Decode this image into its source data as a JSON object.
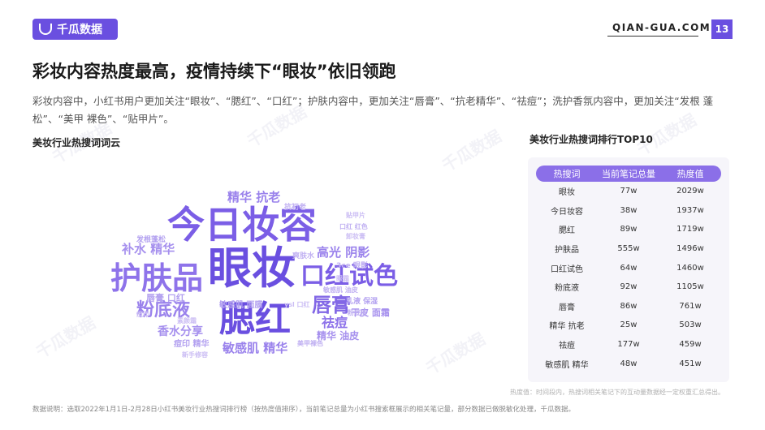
{
  "header": {
    "logo_text": "千瓜数据",
    "site": "QIAN-GUA.COM",
    "page_number": "13",
    "brand_color": "#6a4fe0"
  },
  "title": "彩妆内容热度最高，疫情持续下“眼妆”依旧领跑",
  "description": "彩妆内容中，小红书用户更加关注“眼妆”、“腮红”、“口红”；护肤内容中，更加关注“唇膏”、“抗老精华”、“祛痘”；洗护香氛内容中，更加关注“发根 蓬松”、“美甲 裸色”、“贴甲片”。",
  "word_cloud": {
    "title": "美妆行业热搜词词云",
    "words": [
      {
        "text": "今日妆容",
        "color": "#7b5ee6"
      },
      {
        "text": "眼妆",
        "color": "#6a4fe0"
      },
      {
        "text": "护肤品",
        "color": "#8e73ea"
      },
      {
        "text": "口红试色",
        "color": "#7b5ee6"
      },
      {
        "text": "腮红",
        "color": "#6a4fe0"
      },
      {
        "text": "粉底液",
        "color": "#9a82ec"
      },
      {
        "text": "唇膏",
        "color": "#8267e6"
      },
      {
        "text": "精华 抗老",
        "color": "#9a82ec"
      },
      {
        "text": "补水 精华",
        "color": "#a690ee"
      },
      {
        "text": "高光 阴影",
        "color": "#9a82ec"
      },
      {
        "text": "香水分享",
        "color": "#a690ee"
      },
      {
        "text": "敏感肌 精华",
        "color": "#9a82ec"
      },
      {
        "text": "祛痘",
        "color": "#8e73ea"
      },
      {
        "text": "干皮 面霜",
        "color": "#a690ee"
      },
      {
        "text": "精华 油皮",
        "color": "#a690ee"
      },
      {
        "text": "乳液 保湿",
        "color": "#b3a1f0"
      },
      {
        "text": "唇膏 口红",
        "color": "#b3a1f0"
      },
      {
        "text": "敏感肌 面膜",
        "color": "#b3a1f0"
      },
      {
        "text": "发根蓬松",
        "color": "#b3a1f0"
      },
      {
        "text": "痘印 精华",
        "color": "#b3a1f0"
      },
      {
        "text": "爽肤水",
        "color": "#c0b0f2"
      },
      {
        "text": "3ce 眼影",
        "color": "#c0b0f2"
      },
      {
        "text": "口红 红色",
        "color": "#c0b0f2"
      },
      {
        "text": "抗初老",
        "color": "#c0b0f2"
      },
      {
        "text": "美甲裸色",
        "color": "#c0b0f2"
      },
      {
        "text": "敏感肌 油皮",
        "color": "#c0b0f2"
      },
      {
        "text": "粉底液",
        "color": "#c0b0f2"
      },
      {
        "text": "卸妆膏",
        "color": "#cbbdf4"
      },
      {
        "text": "新手修容",
        "color": "#cbbdf4"
      },
      {
        "text": "贴甲片",
        "color": "#cbbdf4"
      },
      {
        "text": "ysl 口红",
        "color": "#cbbdf4"
      },
      {
        "text": "痘印",
        "color": "#cbbdf4"
      },
      {
        "text": "素颜霜",
        "color": "#cbbdf4"
      },
      {
        "text": "眼霜",
        "color": "#cbbdf4"
      }
    ]
  },
  "ranking": {
    "title": "美妆行业热搜词排行TOP10",
    "header_color": "#8b6fe8",
    "columns": [
      "热搜词",
      "当前笔记总量",
      "热度值"
    ],
    "rows": [
      [
        "眼妆",
        "77w",
        "2029w"
      ],
      [
        "今日妆容",
        "38w",
        "1937w"
      ],
      [
        "腮红",
        "89w",
        "1719w"
      ],
      [
        "护肤品",
        "555w",
        "1496w"
      ],
      [
        "口红试色",
        "64w",
        "1460w"
      ],
      [
        "粉底液",
        "92w",
        "1105w"
      ],
      [
        "唇膏",
        "86w",
        "761w"
      ],
      [
        "精华 抗老",
        "25w",
        "503w"
      ],
      [
        "祛痘",
        "177w",
        "459w"
      ],
      [
        "敏感肌 精华",
        "48w",
        "451w"
      ]
    ],
    "note": "热度值：时间段内，热搜词相关笔记下的互动量数据经一定权重汇总得出。"
  },
  "source": "数据说明：选取2022年1月1日-2月28日小红书美妆行业热搜词排行榜（按热度值排序），当前笔记总量为小红书搜索框展示的相关笔记量，部分数据已做脱敏化处理，千瓜数据。"
}
